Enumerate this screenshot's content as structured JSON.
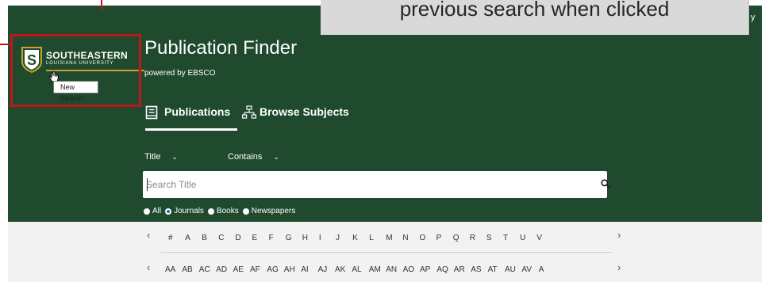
{
  "annotation": {
    "callout_text": "previous search when clicked",
    "partial_char": "y"
  },
  "logo": {
    "letter": "S",
    "name": "SOUTHEASTERN",
    "sub": "LOUISIANA UNIVERSITY"
  },
  "tooltip": "New Search",
  "header": {
    "title": "Publication Finder",
    "subtitle": "powered by EBSCO"
  },
  "tabs": [
    {
      "label": "Publications",
      "active": true
    },
    {
      "label": "Browse Subjects",
      "active": false
    }
  ],
  "filters": {
    "field": "Title",
    "operator": "Contains"
  },
  "search": {
    "placeholder": "Search Title",
    "value": ""
  },
  "radios": [
    {
      "label": "All",
      "selected": false
    },
    {
      "label": "Journals",
      "selected": true
    },
    {
      "label": "Books",
      "selected": false
    },
    {
      "label": "Newspapers",
      "selected": false
    }
  ],
  "alphabet_row1": [
    "#",
    "A",
    "B",
    "C",
    "D",
    "E",
    "F",
    "G",
    "H",
    "I",
    "J",
    "K",
    "L",
    "M",
    "N",
    "O",
    "P",
    "Q",
    "R",
    "S",
    "T",
    "U",
    "V"
  ],
  "alphabet_row2": [
    "AA",
    "AB",
    "AC",
    "AD",
    "AE",
    "AF",
    "AG",
    "AH",
    "AI",
    "AJ",
    "AK",
    "AL",
    "AM",
    "AN",
    "AO",
    "AP",
    "AQ",
    "AR",
    "AS",
    "AT",
    "AU",
    "AV",
    "A"
  ],
  "colors": {
    "header_bg": "#1f4a2e",
    "accent_gold": "#c9a227",
    "annotation_red": "#c0161b",
    "radio_selected": "#1b66c9"
  },
  "icons": {
    "publications": "book-icon",
    "browse": "hierarchy-icon",
    "search": "search-icon",
    "prev": "chevron-left-icon",
    "next": "chevron-right-icon"
  }
}
